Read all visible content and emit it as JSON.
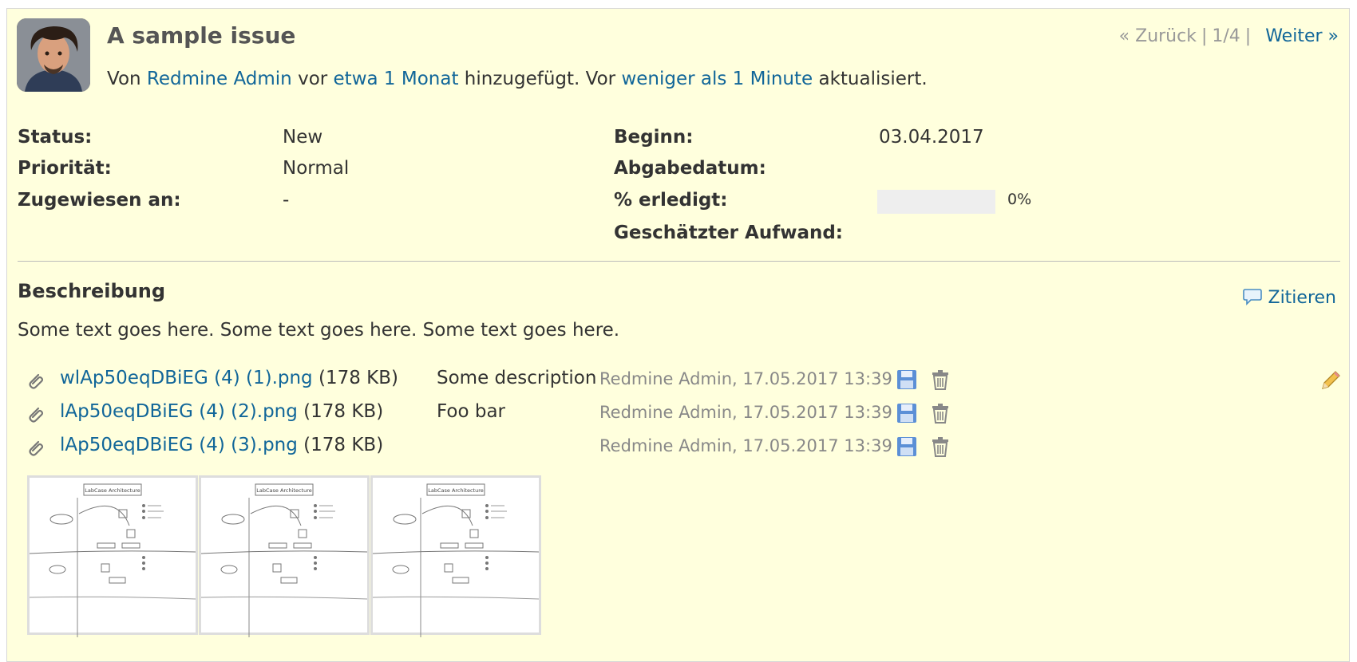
{
  "issue": {
    "title": "A sample issue",
    "author_prefix": "Von",
    "author": "Redmine Admin",
    "added_prefix": "vor",
    "added_ago": "etwa 1 Monat",
    "added_suffix": "hinzugefügt. Vor",
    "updated_ago": "weniger als 1 Minute",
    "updated_suffix": "aktualisiert."
  },
  "nav": {
    "prev": "« Zurück",
    "position": "1/4",
    "next": "Weiter »"
  },
  "attributes": {
    "status_label": "Status:",
    "status": "New",
    "priority_label": "Priorität:",
    "priority": "Normal",
    "assigned_label": "Zugewiesen an:",
    "assigned": "-",
    "start_label": "Beginn:",
    "start": "03.04.2017",
    "due_label": "Abgabedatum:",
    "due": "",
    "done_label": "% erledigt:",
    "done": "0%",
    "done_fraction": 0,
    "estimate_label": "Geschätzter Aufwand:",
    "estimate": ""
  },
  "description": {
    "heading": "Beschreibung",
    "quote_label": "Zitieren",
    "text": "Some text goes here. Some text goes here. Some text goes here."
  },
  "attachments": [
    {
      "name": "wlAp50eqDBiEG (4) (1).png",
      "size": "(178 KB)",
      "desc": "Some description",
      "meta": "Redmine Admin, 17.05.2017 13:39"
    },
    {
      "name": "lAp50eqDBiEG (4) (2).png",
      "size": "(178 KB)",
      "desc": "Foo bar",
      "meta": "Redmine Admin, 17.05.2017 13:39"
    },
    {
      "name": "lAp50eqDBiEG (4) (3).png",
      "size": "(178 KB)",
      "desc": "",
      "meta": "Redmine Admin, 17.05.2017 13:39"
    }
  ],
  "thumbnails": [
    {
      "caption": "LabCase Architecture"
    },
    {
      "caption": "LabCase Architecture"
    },
    {
      "caption": "LabCase Architecture"
    }
  ],
  "icons": {
    "attachment": "paperclip-icon",
    "download": "floppy-disk-icon",
    "delete": "trash-icon",
    "edit": "pencil-icon",
    "quote": "speech-bubble-icon"
  },
  "colors": {
    "background": "#ffffdd",
    "link": "#116699",
    "muted": "#888888"
  }
}
